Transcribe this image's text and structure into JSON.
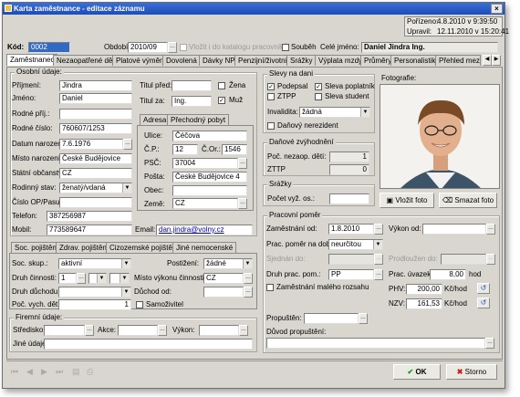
{
  "window": {
    "title": "Karta zaměstnance - editace záznamu",
    "close": "×"
  },
  "info": {
    "porizeno_label": "Pořízeno:",
    "porizeno": "4.8.2010 v 9:39:50",
    "upraveno_label": "Upravil:",
    "upraveno": "12.11.2010 v 15:20:41"
  },
  "top": {
    "kod_label": "Kód:",
    "kod": "0002",
    "obdobi_label": "Období:",
    "obdobi": "2010/09",
    "vlozit_label": "Vložit i do katalogu pracovníků",
    "soubeh_label": "Souběh",
    "cele_jmeno_label": "Celé jméno:",
    "cele_jmeno": "Daniel Jindra Ing."
  },
  "tabs": [
    "Zaměstnanec",
    "Nezaopatřené děti",
    "Platové výměry",
    "Dovolená",
    "Dávky NP",
    "Penzijní/životní",
    "Srážky",
    "Výplata mzdy",
    "Průměry",
    "Personalistika",
    "Přehled mezd"
  ],
  "osobni": {
    "title": "Osobní údaje:",
    "prijmeni_l": "Příjmení:",
    "prijmeni": "Jindra",
    "jmeno_l": "Jméno:",
    "jmeno": "Daniel",
    "rodne_prijm_l": "Rodné příj.:",
    "rodne_prijm": "",
    "rodne_cislo_l": "Rodné číslo:",
    "rodne_cislo": "760607/1253",
    "datum_l": "Datum narození:",
    "datum": "7.6.1976",
    "misto_l": "Místo narození:",
    "misto": "České Budějovice",
    "obcanstvi_l": "Státní občanství:",
    "obcanstvi": "CZ",
    "stav_l": "Rodinný stav:",
    "stav": "ženatý/vdaná",
    "op_l": "Číslo OP/Pasu:",
    "op": "",
    "telefon_l": "Telefon:",
    "telefon": "387256987",
    "mobil_l": "Mobil:",
    "mobil": "773589647",
    "email_l": "Email:",
    "email": "dan.jindra@volny.cz",
    "titul_pred_l": "Titul před:",
    "titul_pred": "",
    "titul_za_l": "Titul za:",
    "titul_za": "Ing.",
    "zena_l": "Žena",
    "muz_l": "Muž"
  },
  "adresa": {
    "tab1": "Adresa",
    "tab2": "Přechodný pobyt",
    "ulice_l": "Ulice:",
    "ulice": "Čéčova",
    "cp_l": "Č.P.:",
    "cp": "12",
    "co_l": "Č.Or.:",
    "co": "1546",
    "psc_l": "PSČ:",
    "psc": "37004",
    "posta_l": "Pošta:",
    "posta": "České Budějovice 4",
    "obec_l": "Obec:",
    "obec": "",
    "zeme_l": "Země:",
    "zeme": "CZ"
  },
  "slevy": {
    "title": "Slevy na dani",
    "podepsal": "Podepsal",
    "poplatnik": "Sleva poplatník",
    "ztpp": "ZTPP",
    "student": "Sleva student",
    "invalidita_l": "Invalidita:",
    "invalidita": "žádná",
    "nerezident": "Daňový nerezident"
  },
  "zvyhodneni": {
    "title": "Daňové zvýhodnění",
    "deti_l": "Poč. nezaop. dětí:",
    "deti": "1",
    "ztp_l": "ZTTP",
    "ztp": "0"
  },
  "srazky": {
    "title": "Srážky",
    "pocet_l": "Počet vyž. os.:",
    "pocet": ""
  },
  "foto": {
    "title": "Fotografie:",
    "vlozit": "Vložit foto",
    "smazat": "Smazat foto"
  },
  "pojisteni": {
    "tabs": [
      "Soc. pojištění",
      "Zdrav. pojištění",
      "Cizozemské pojištění",
      "Jiné nemocenské"
    ],
    "skup_l": "Soc. skup.:",
    "skup": "aktivní",
    "postizeni_l": "Postižení:",
    "postizeni": "žádné",
    "druh_cin_l": "Druh činnosti:",
    "druh_cin": "1",
    "misto_vyk_l": "Místo výkonu činnosti:",
    "misto_vyk": "CZ",
    "druh_duch_l": "Druh důchodu:",
    "duchod_od_l": "Důchod od:",
    "poc_deti_l": "Poč. vych. dětí:",
    "poc_deti": "1",
    "samozivitel": "Samoživitel"
  },
  "firemni": {
    "title": "Firemní údaje:",
    "stredisko_l": "Středisko:",
    "akce_l": "Akce:",
    "vykon_l": "Výkon:",
    "jine_l": "Jiné údaje:"
  },
  "pracovni": {
    "title": "Pracovní poměr",
    "nastup_l": "Zaměstnání od:",
    "nastup": "1.8.2010",
    "vykon_od_l": "Výkon od:",
    "doba_l": "Prac. poměr na dobu:",
    "doba": "neurčitou",
    "sjednano_l": "Sjednán do:",
    "prodlouzen_l": "Prodloužen do:",
    "druh_l": "Druh prac. pom.:",
    "druh": "PP",
    "uvazek_l": "Prac. úvazek:",
    "uvazek": "8,00",
    "uvazek_unit": "hod",
    "maly_rozsah": "Zaměstnání malého rozsahu",
    "phv_l": "PHV:",
    "phv": "200,00",
    "phv_unit": "Kč/hod",
    "nzv_l": "NZV:",
    "nzv": "161,53",
    "nzv_unit": "Kč/hod",
    "propusten_l": "Propuštěn:",
    "duvod_l": "Důvod propuštění:"
  },
  "footer": {
    "ok": "OK",
    "storno": "Storno"
  }
}
